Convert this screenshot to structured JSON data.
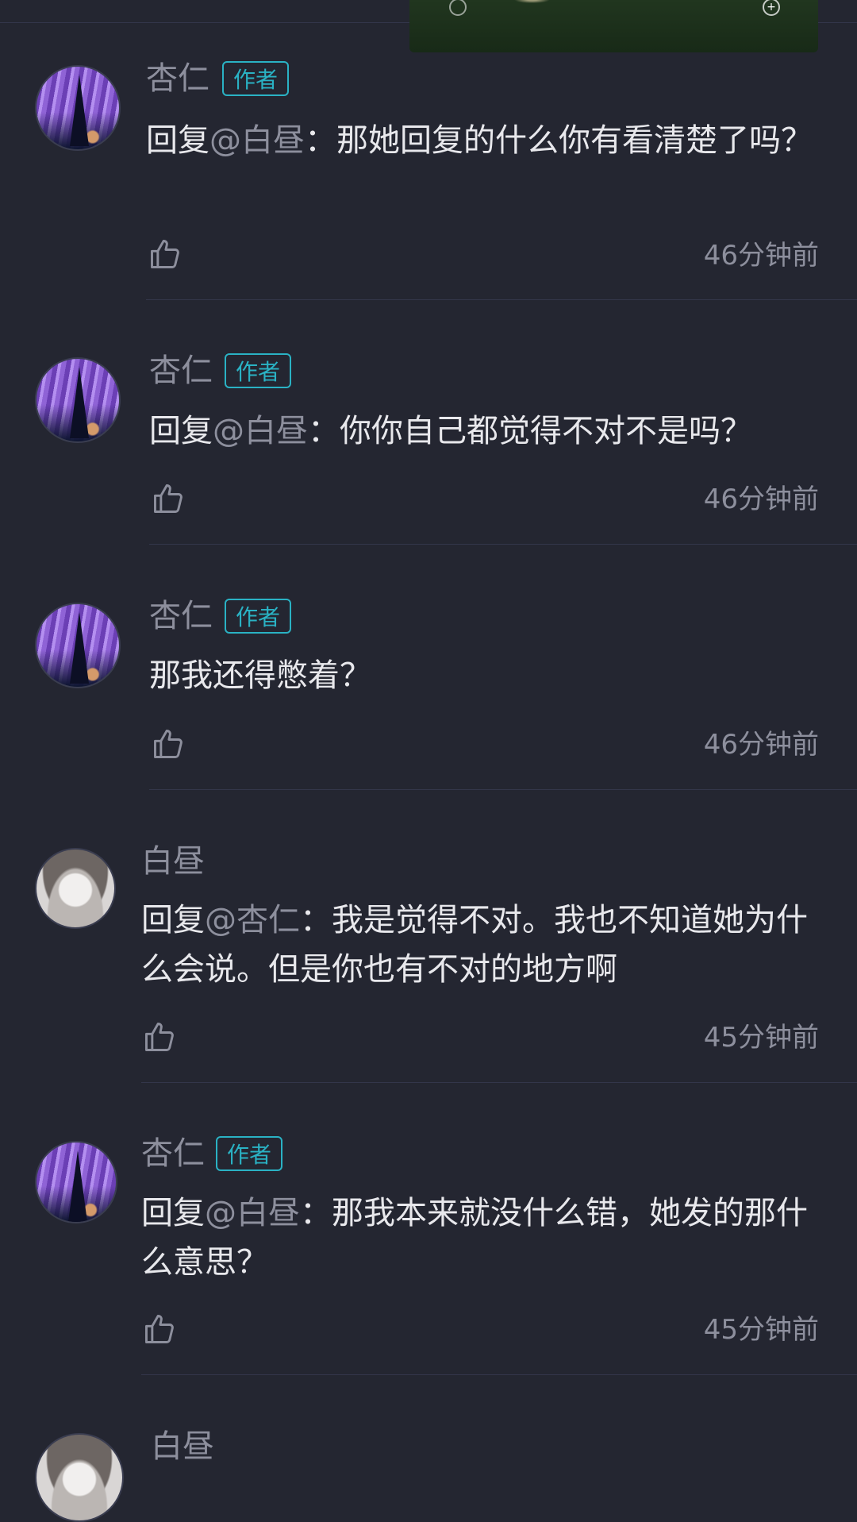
{
  "labels": {
    "author_badge": "作者",
    "reply_prefix": "回复",
    "colon": "："
  },
  "comments": [
    {
      "user": "杏仁",
      "avatar": "apricot-avatar",
      "is_author": true,
      "reply_to": "@白昼",
      "text": "那她回复的什么你有看清楚了吗？",
      "time": "46分钟前"
    },
    {
      "user": "杏仁",
      "avatar": "apricot-avatar",
      "is_author": true,
      "reply_to": "@白昼",
      "text": "你你自己都觉得不对不是吗？",
      "time": "46分钟前"
    },
    {
      "user": "杏仁",
      "avatar": "apricot-avatar",
      "is_author": true,
      "reply_to": null,
      "text": "那我还得憋着？",
      "time": "46分钟前"
    },
    {
      "user": "白昼",
      "avatar": "noon-avatar",
      "is_author": false,
      "reply_to": "@杏仁",
      "text": "我是觉得不对。我也不知道她为什么会说。但是你也有不对的地方啊",
      "time": "45分钟前"
    },
    {
      "user": "杏仁",
      "avatar": "apricot-avatar",
      "is_author": true,
      "reply_to": "@白昼",
      "text": "那我本来就没什么错，她发的那什么意思？",
      "time": "45分钟前"
    },
    {
      "user": "白昼",
      "avatar": "noon-avatar",
      "is_author": false
    }
  ],
  "icons": {
    "like": "thumbs-up-icon",
    "media_ring": "circle-icon",
    "media_add": "plus-circle-icon"
  },
  "colors": {
    "background": "#242631",
    "author_badge": "#2ab2c4",
    "username": "#8d8f9d",
    "body_text": "#e8e8ec",
    "divider": "#33364a"
  }
}
